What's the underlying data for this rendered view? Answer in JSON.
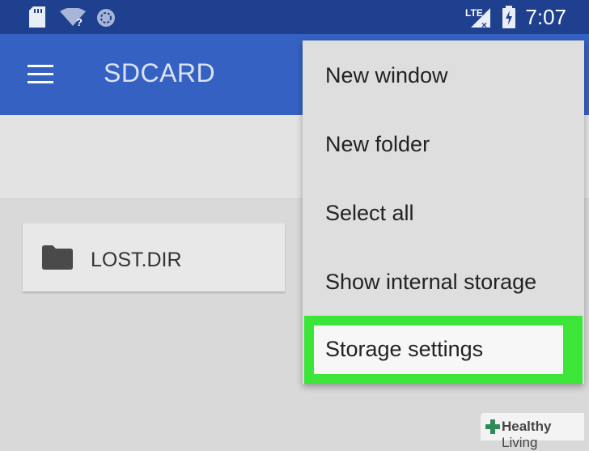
{
  "status_bar": {
    "time": "7:07",
    "network_label": "LTE",
    "icons": [
      "sd-card-icon",
      "wifi-unknown-icon",
      "sync-icon",
      "lte-signal-icon",
      "battery-charging-icon"
    ]
  },
  "app_bar": {
    "title": "SDCARD",
    "menu_icon": "hamburger-menu-icon"
  },
  "files": [
    {
      "name": "LOST.DIR",
      "icon": "folder-icon"
    }
  ],
  "overflow_menu": {
    "items": [
      {
        "label": "New window"
      },
      {
        "label": "New folder"
      },
      {
        "label": "Select all"
      },
      {
        "label": "Show internal storage"
      },
      {
        "label": "Storage settings",
        "highlighted": true
      }
    ]
  },
  "watermark": {
    "bold": "Healthy",
    "light": "Living"
  },
  "colors": {
    "status_bar": "#1f3f8f",
    "app_bar": "#3561c2",
    "highlight": "#3ce638",
    "background": "#d9d9d9"
  }
}
